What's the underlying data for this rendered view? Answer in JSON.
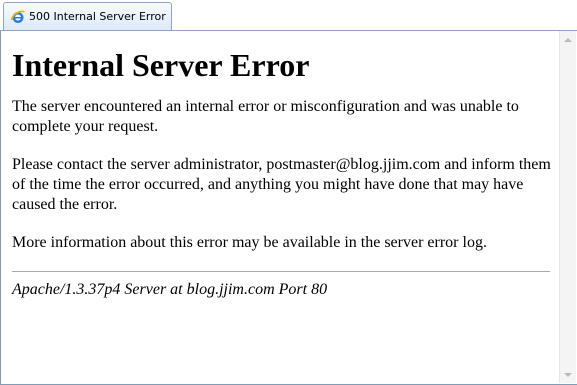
{
  "tab": {
    "title": "500 Internal Server Error",
    "icon": "ie-icon"
  },
  "page": {
    "heading": "Internal Server Error",
    "p1": "The server encountered an internal error or misconfiguration and was unable to complete your request.",
    "p2": "Please contact the server administrator, postmaster@blog.jjim.com and inform them of the time the error occurred, and anything you might have done that may have caused the error.",
    "p3": "More information about this error may be available in the server error log.",
    "address": "Apache/1.3.37p4 Server at blog.jjim.com Port 80"
  },
  "colors": {
    "tab_border": "#8aa7c7",
    "frame_border": "#7f9db9"
  }
}
